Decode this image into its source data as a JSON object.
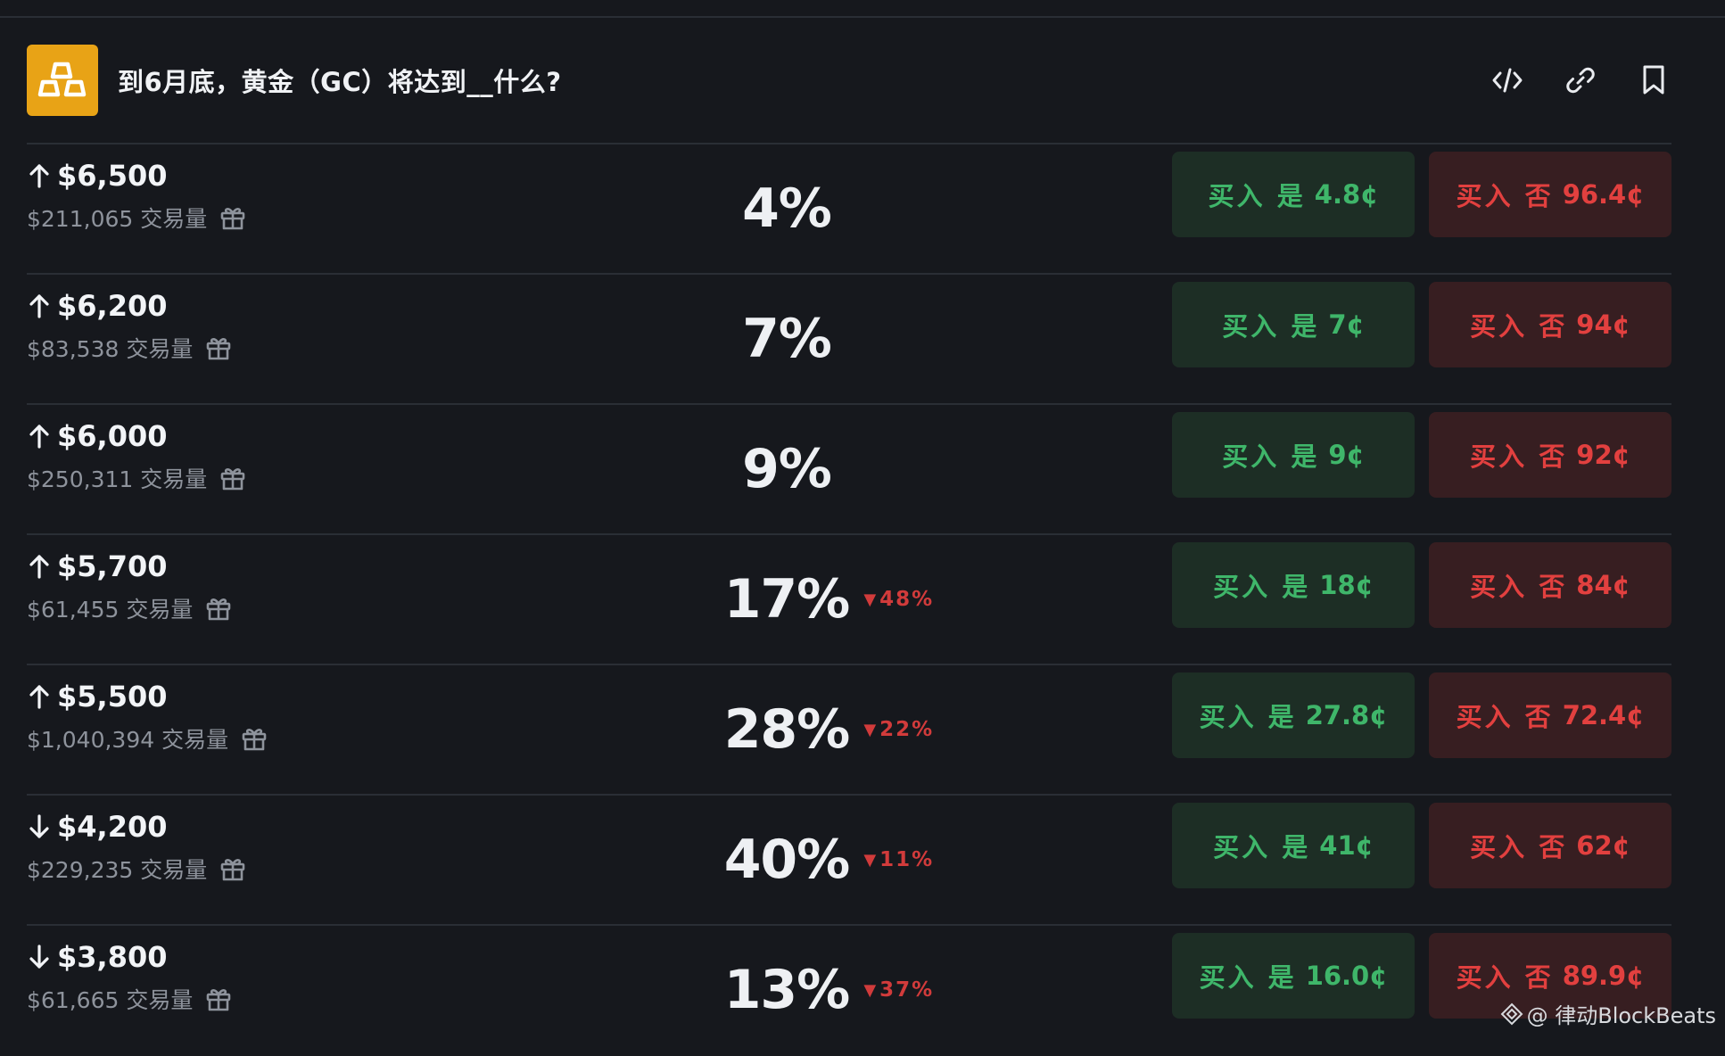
{
  "market": {
    "title": "到6月底，黄金（GC）将达到__什么?",
    "logo_icon": "gold-bars-icon",
    "actions": [
      {
        "name": "embed-code-icon"
      },
      {
        "name": "copy-link-icon"
      },
      {
        "name": "bookmark-icon"
      }
    ]
  },
  "colors": {
    "yes_bg": "#1d2e25",
    "yes_text": "#3fb66a",
    "no_bg": "#371e21",
    "no_text": "#e2403f",
    "logo_bg": "#e8a316",
    "down_change": "#d13b3b"
  },
  "rows": [
    {
      "direction": "up",
      "strike": "$6,500",
      "volume": "$211,065 交易量",
      "probability": "4%",
      "change": "",
      "yes_label": "买入 是",
      "yes_price": "4.8¢",
      "no_label": "买入 否",
      "no_price": "96.4¢"
    },
    {
      "direction": "up",
      "strike": "$6,200",
      "volume": "$83,538 交易量",
      "probability": "7%",
      "change": "",
      "yes_label": "买入 是",
      "yes_price": "7¢",
      "no_label": "买入 否",
      "no_price": "94¢"
    },
    {
      "direction": "up",
      "strike": "$6,000",
      "volume": "$250,311 交易量",
      "probability": "9%",
      "change": "",
      "yes_label": "买入 是",
      "yes_price": "9¢",
      "no_label": "买入 否",
      "no_price": "92¢"
    },
    {
      "direction": "up",
      "strike": "$5,700",
      "volume": "$61,455 交易量",
      "probability": "17%",
      "change": "48%",
      "yes_label": "买入 是",
      "yes_price": "18¢",
      "no_label": "买入 否",
      "no_price": "84¢"
    },
    {
      "direction": "up",
      "strike": "$5,500",
      "volume": "$1,040,394 交易量",
      "probability": "28%",
      "change": "22%",
      "yes_label": "买入 是",
      "yes_price": "27.8¢",
      "no_label": "买入 否",
      "no_price": "72.4¢"
    },
    {
      "direction": "down",
      "strike": "$4,200",
      "volume": "$229,235 交易量",
      "probability": "40%",
      "change": "11%",
      "yes_label": "买入 是",
      "yes_price": "41¢",
      "no_label": "买入 否",
      "no_price": "62¢"
    },
    {
      "direction": "down",
      "strike": "$3,800",
      "volume": "$61,665 交易量",
      "probability": "13%",
      "change": "37%",
      "yes_label": "买入 是",
      "yes_price": "16.0¢",
      "no_label": "买入 否",
      "no_price": "89.9¢"
    }
  ],
  "watermark": {
    "text": "@ 律动BlockBeats"
  }
}
